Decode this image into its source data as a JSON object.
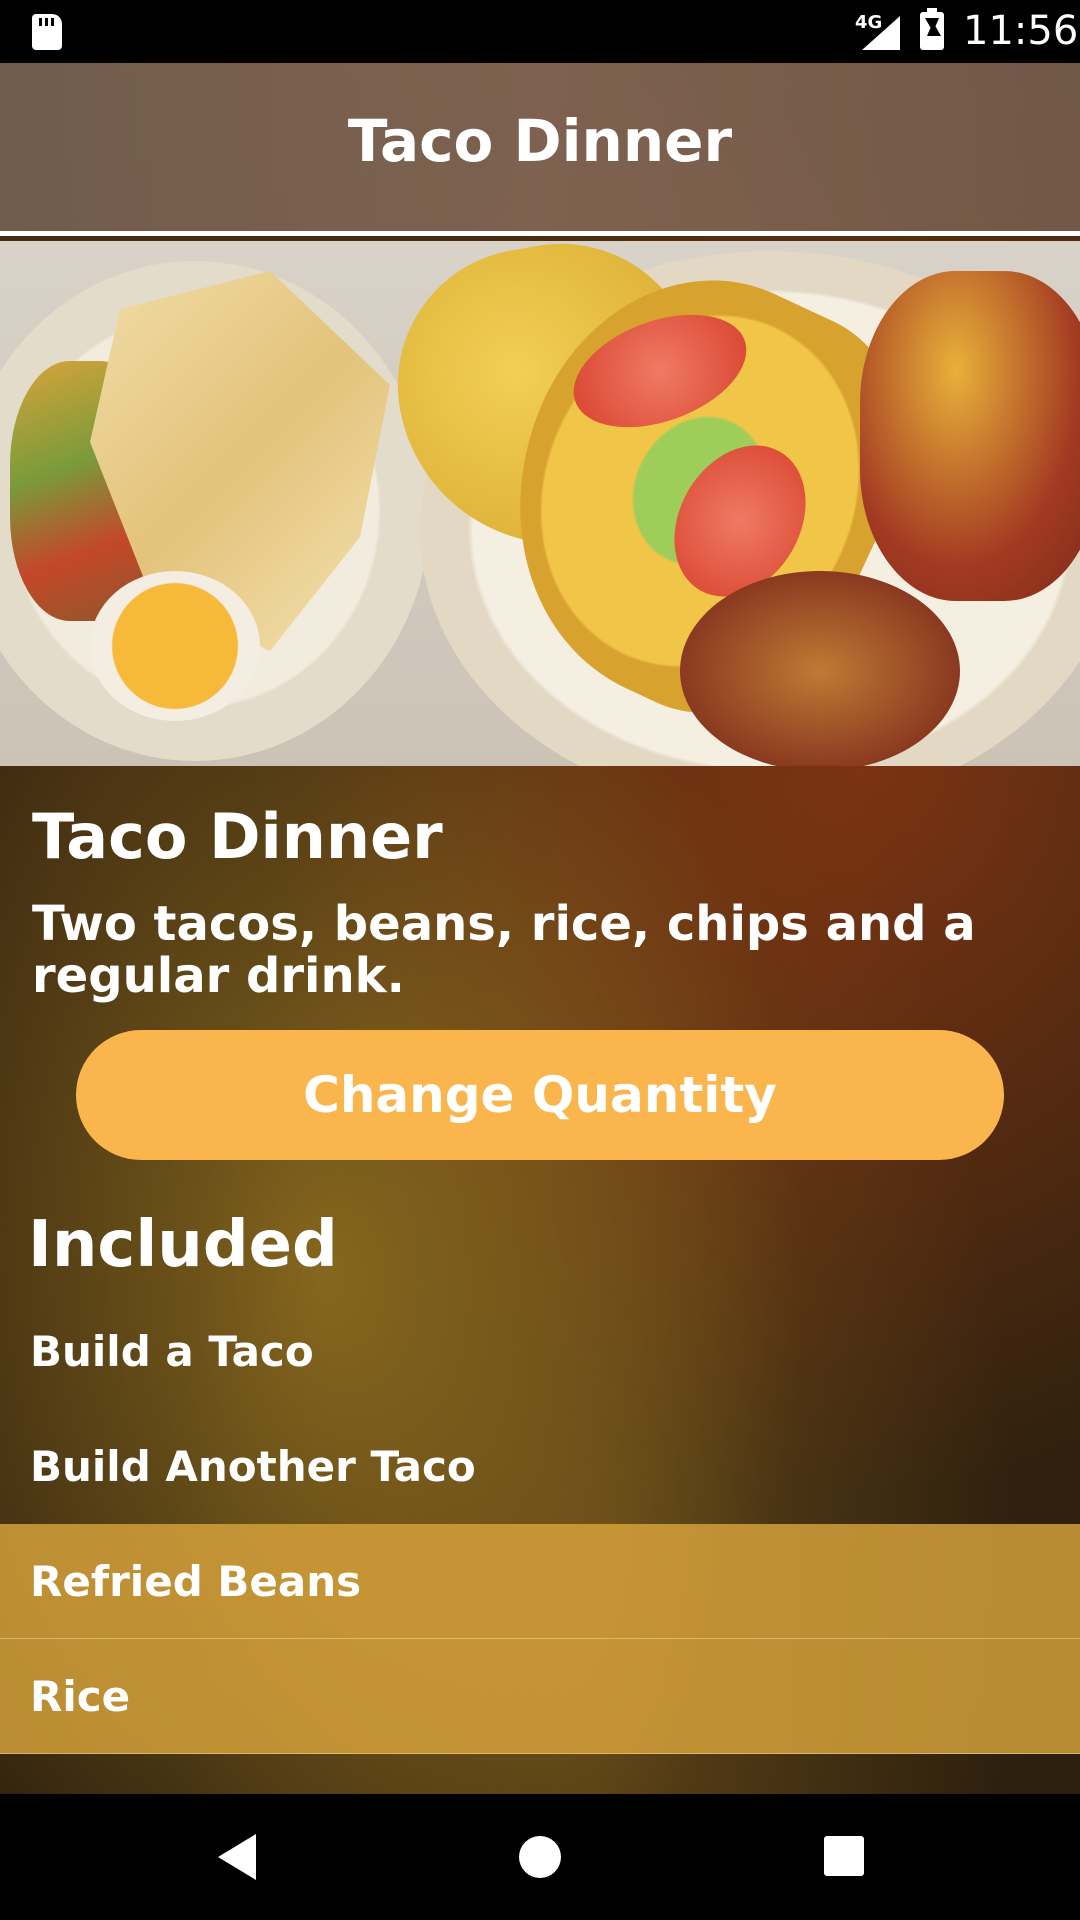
{
  "status_bar": {
    "network": "4G",
    "time": "11:56"
  },
  "header": {
    "title": "Taco Dinner"
  },
  "item": {
    "name": "Taco Dinner",
    "description": "Two tacos, beans, rice, chips and a regular drink.",
    "change_quantity_label": "Change Quantity"
  },
  "included": {
    "title": "Included",
    "items": [
      {
        "label": "Build a Taco",
        "selected": false
      },
      {
        "label": "Build Another Taco",
        "selected": false
      },
      {
        "label": "Refried Beans",
        "selected": true
      },
      {
        "label": "Rice",
        "selected": true
      }
    ]
  },
  "colors": {
    "accent": "#fbb54d",
    "selected_row": "#d8a33c"
  }
}
